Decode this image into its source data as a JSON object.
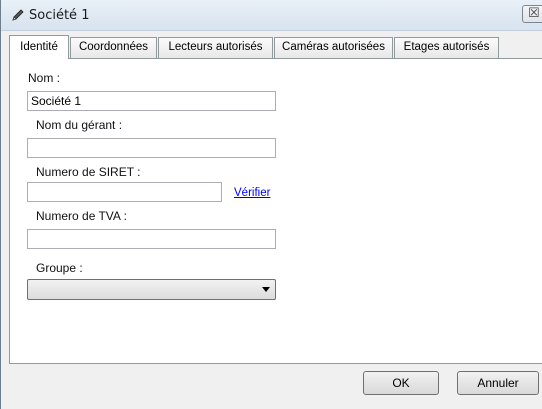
{
  "window": {
    "title": "Société 1",
    "close_glyph": "☒"
  },
  "tabs": [
    {
      "label": "Identité",
      "active": true
    },
    {
      "label": "Coordonnées"
    },
    {
      "label": "Lecteurs autorisés"
    },
    {
      "label": "Caméras autorisées"
    },
    {
      "label": "Etages autorisés"
    }
  ],
  "form": {
    "nom_label": "Nom :",
    "nom_value": "Société 1",
    "gerant_label": "Nom du gérant :",
    "gerant_value": "",
    "siret_label": "Numero de SIRET :",
    "siret_value": "",
    "verify_link": "Vérifier",
    "tva_label": "Numero de TVA :",
    "tva_value": "",
    "groupe_label": "Groupe :",
    "groupe_value": ""
  },
  "buttons": {
    "ok": "OK",
    "cancel": "Annuler"
  }
}
